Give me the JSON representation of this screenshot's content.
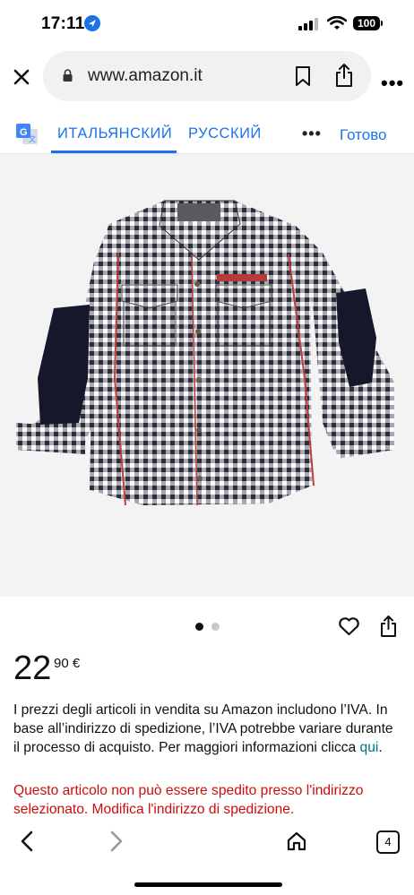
{
  "status": {
    "time": "17:11",
    "battery": "100"
  },
  "browser": {
    "url": "www.amazon.it"
  },
  "translate": {
    "source_lang": "ИТАЛЬЯНСКИЙ",
    "target_lang": "РУССКИЙ",
    "done": "Готово"
  },
  "carousel": {
    "current": 1,
    "total": 2
  },
  "price": {
    "whole": "22",
    "fraction": "90 €"
  },
  "vat_notice": {
    "text": "I prezzi degli articoli in vendita su Amazon includono l’IVA. In base all’indirizzo di spedizione, l’IVA potrebbe variare durante il processo di acquisto. Per maggiori informazioni clicca ",
    "link": "qui",
    "end": "."
  },
  "shipping_warning": "Questo articolo non può essere spedito presso l'indirizzo selezionato. Modifica l'indirizzo di spedizione.",
  "bottom_nav": {
    "tabs_count": "4"
  },
  "colors": {
    "accent": "#1a73e8",
    "warning": "#cc0c0c",
    "link": "#007185"
  }
}
